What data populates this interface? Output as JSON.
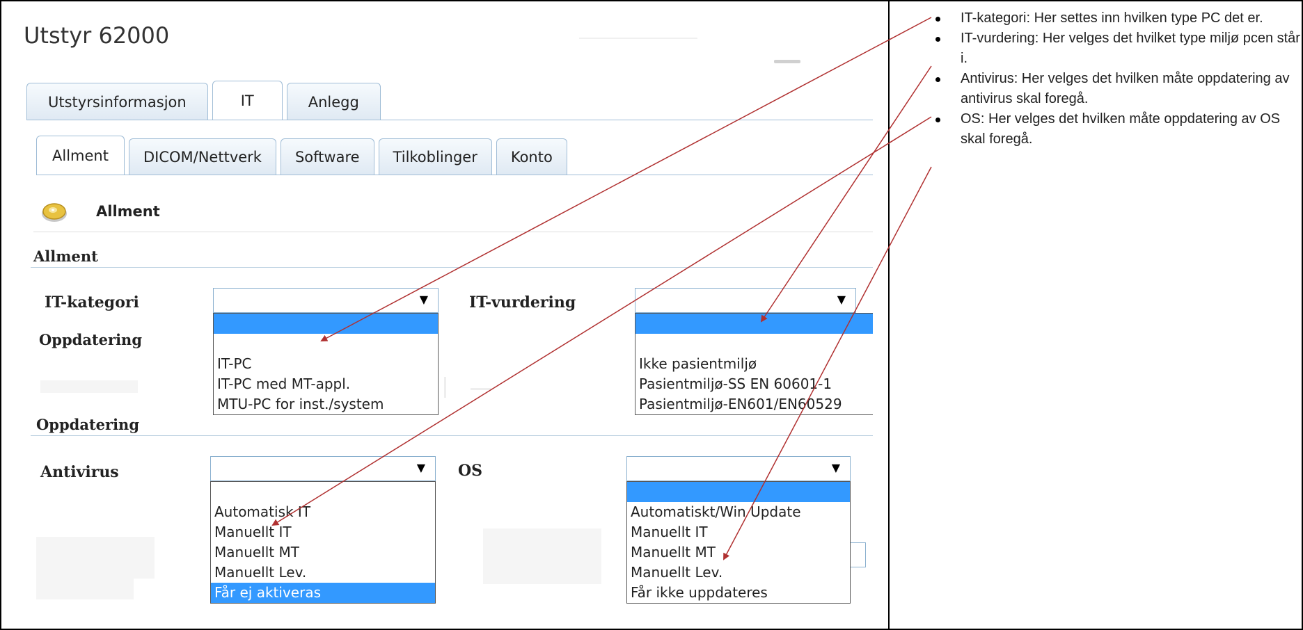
{
  "app": {
    "title": "Utstyr 62000",
    "main_tabs": [
      "Utstyrsinformasjon",
      "IT",
      "Anlegg"
    ],
    "sub_tabs": [
      "Allment",
      "DICOM/Nettverk",
      "Software",
      "Tilkoblinger",
      "Konto"
    ],
    "section_title": "Allment",
    "groups": {
      "allment": "Allment",
      "oppdatering_hidden": "Oppdatering",
      "oppdatering": "Oppdatering"
    },
    "fields": {
      "it_kategori": {
        "label": "IT-kategori",
        "options": [
          "IT-PC",
          "IT-PC med MT-appl.",
          "MTU-PC for inst./system"
        ]
      },
      "it_vurdering": {
        "label": "IT-vurdering",
        "options": [
          "Ikke pasientmiljø",
          "Pasientmiljø-SS EN 60601-1",
          "Pasientmiljø-EN601/EN60529"
        ]
      },
      "antivirus": {
        "label": "Antivirus",
        "options": [
          "Automatisk IT",
          "Manuellt IT",
          "Manuellt MT",
          "Manuellt Lev.",
          "Får ej aktiveras"
        ]
      },
      "os": {
        "label": "OS",
        "options": [
          "Automatiskt/Win Update",
          "Manuellt IT",
          "Manuellt MT",
          "Manuellt Lev.",
          "Får ikke uppdateres"
        ]
      }
    }
  },
  "notes": [
    "IT-kategori: Her settes inn hvilken type PC det er.",
    "IT-vurdering: Her velges det hvilket type miljø pcen står i.",
    "Antivirus: Her velges det hvilken måte oppdatering av antivirus skal foregå.",
    "OS: Her velges det hvilken måte oppdatering av OS skal foregå."
  ],
  "colors": {
    "highlight": "#3399ff",
    "tab_border": "#9fbcd6",
    "arrow": "#b03030"
  }
}
